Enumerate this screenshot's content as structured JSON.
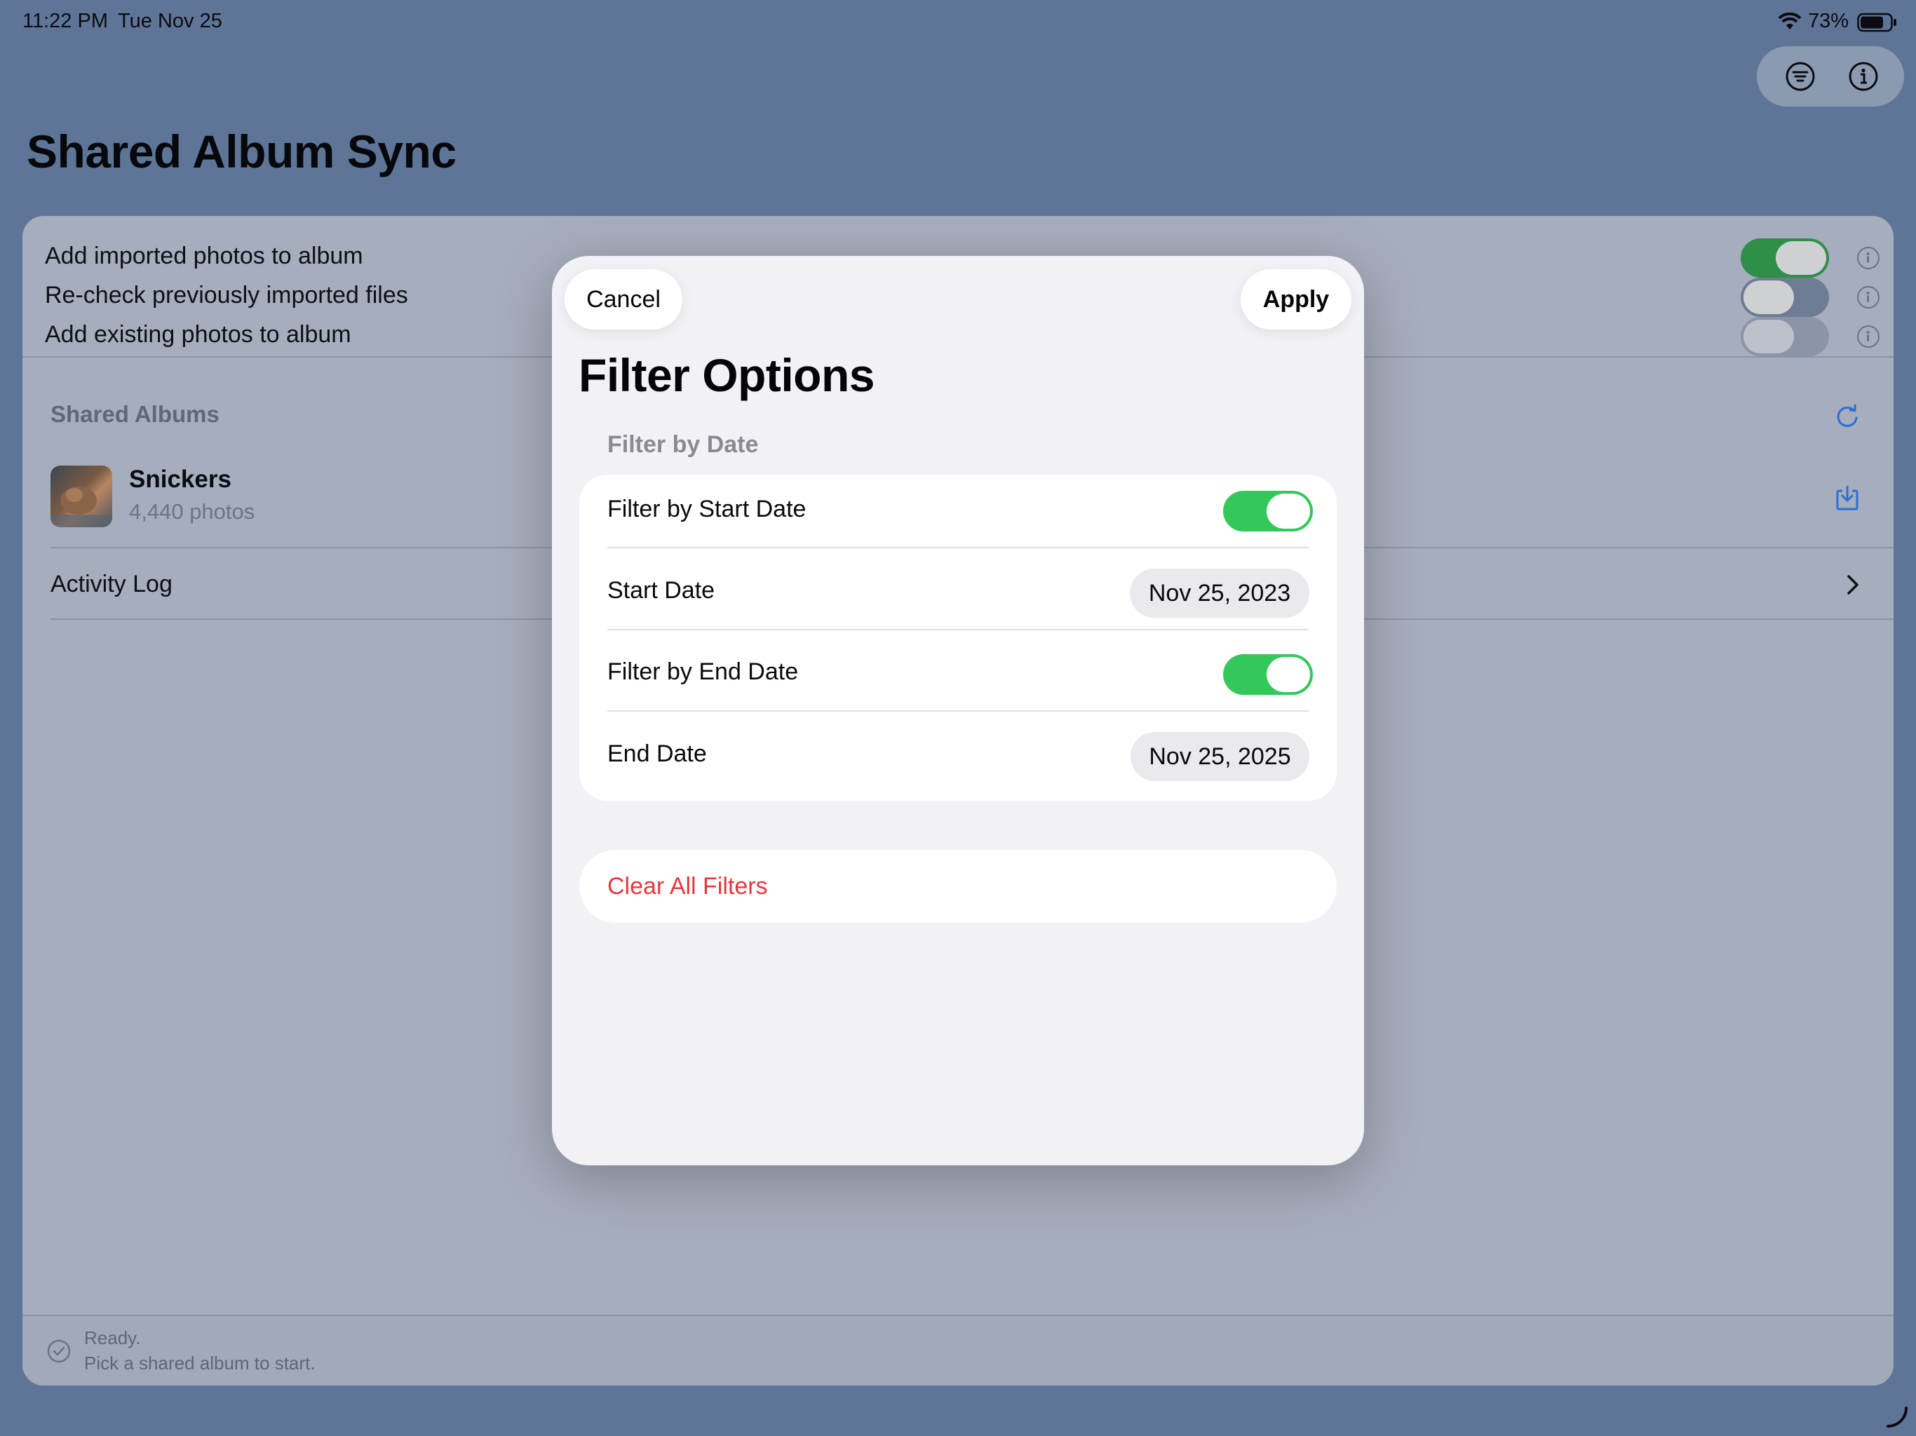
{
  "status_bar": {
    "time": "11:22 PM",
    "date": "Tue Nov 25",
    "battery": "73%"
  },
  "page": {
    "title": "Shared Album Sync"
  },
  "options": [
    {
      "label": "Add imported photos to album",
      "enabled": true
    },
    {
      "label": "Re-check previously imported files",
      "enabled": false
    },
    {
      "label": "Add existing photos to album",
      "enabled": false
    }
  ],
  "shared_albums": {
    "header": "Shared Albums",
    "album": {
      "name": "Snickers",
      "count": "4,440 photos"
    },
    "activity_log": "Activity Log"
  },
  "footer": {
    "status": "Ready.",
    "hint": "Pick a shared album to start."
  },
  "modal": {
    "cancel_label": "Cancel",
    "apply_label": "Apply",
    "title": "Filter Options",
    "section_header": "Filter by Date",
    "filter_start_label": "Filter by Start Date",
    "filter_start_enabled": true,
    "start_date_label": "Start Date",
    "start_date_value": "Nov 25, 2023",
    "filter_end_label": "Filter by End Date",
    "filter_end_enabled": true,
    "end_date_label": "End Date",
    "end_date_value": "Nov 25, 2025",
    "clear_label": "Clear All Filters"
  },
  "colors": {
    "accent_green": "#34c759",
    "destructive_red": "#e5383b",
    "link_blue": "#2a6fd6"
  }
}
